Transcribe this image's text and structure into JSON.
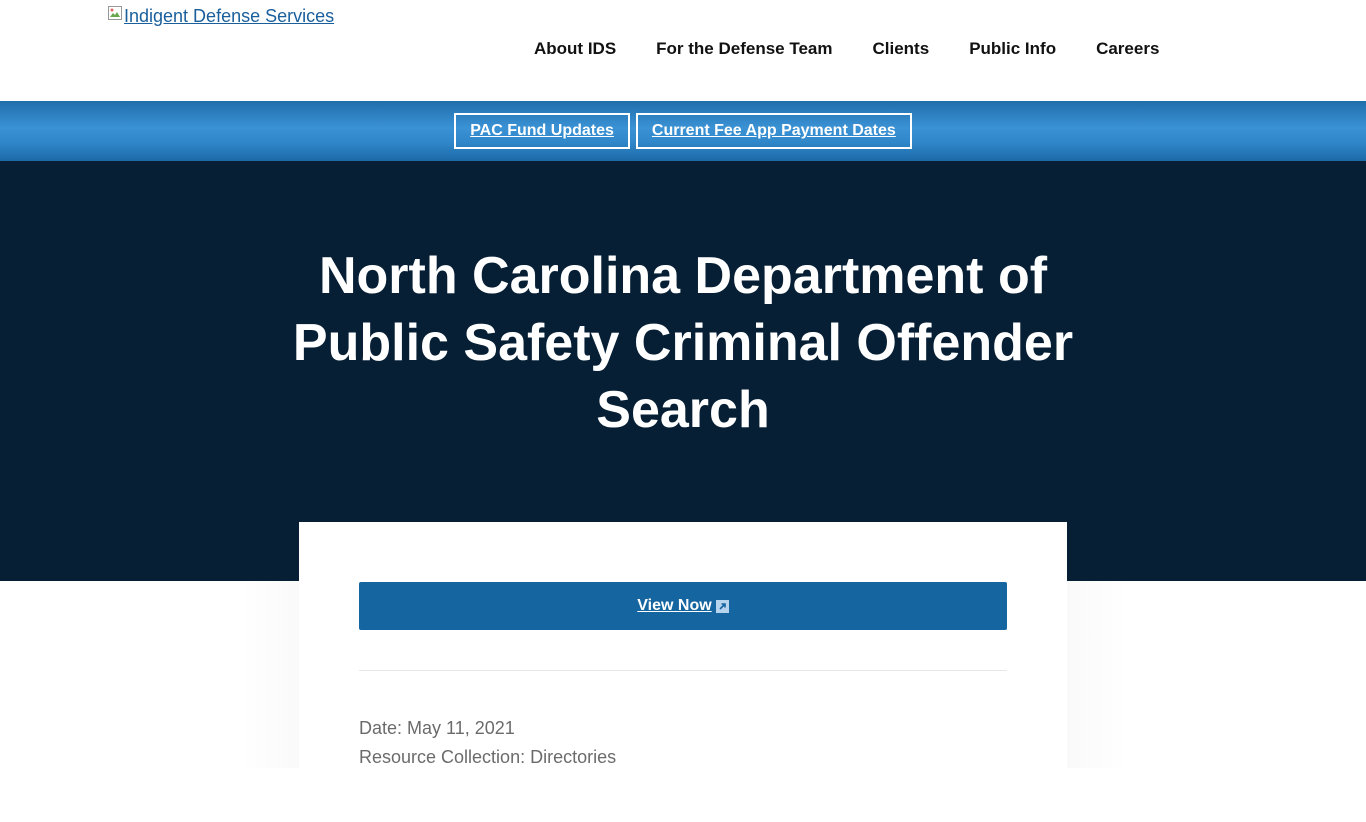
{
  "header": {
    "logo_alt": "Indigent Defense Services",
    "nav": [
      {
        "label": "About IDS"
      },
      {
        "label": "For the Defense Team"
      },
      {
        "label": "Clients"
      },
      {
        "label": "Public Info"
      },
      {
        "label": "Careers"
      }
    ]
  },
  "alerts": {
    "items": [
      {
        "label": "PAC Fund Updates"
      },
      {
        "label": "Current Fee App Payment Dates"
      }
    ]
  },
  "hero": {
    "title": "North Carolina Department of Public Safety Criminal Offender Search"
  },
  "card": {
    "view_label": "View Now",
    "date_line": "Date: May 11, 2021",
    "collection_line": "Resource Collection: Directories"
  },
  "colors": {
    "hero_bg": "#061f35",
    "button_blue": "#1565a0",
    "alert_blue": "#2f86c8",
    "link_blue": "#1a5f9c"
  },
  "icons": {
    "broken_image": "broken-image-icon",
    "external_link": "external-link-icon"
  }
}
